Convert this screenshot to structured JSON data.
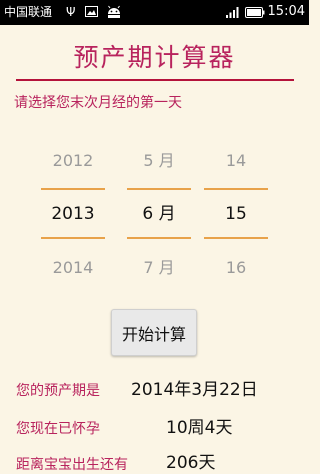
{
  "status_bar": {
    "carrier": "中国联通",
    "time": "15:04",
    "icons": [
      "usb-icon",
      "image-icon",
      "android-icon",
      "signal-icon",
      "battery-icon"
    ]
  },
  "app": {
    "title": "预产期计算器",
    "instruction": "请选择您末次月经的第一天"
  },
  "picker": {
    "year": {
      "prev": "2012",
      "selected": "2013",
      "next": "2014"
    },
    "month": {
      "prev": "5 月",
      "selected": "6 月",
      "next": "7 月"
    },
    "day": {
      "prev": "14",
      "selected": "15",
      "next": "16"
    }
  },
  "start_button": {
    "label": "开始计算"
  },
  "results": {
    "due_date_label": "您的预产期是",
    "due_date_value": "2014年3月22日",
    "pregnant_label": "您现在已怀孕",
    "pregnant_value": "10周4天",
    "remaining_label": "距离宝宝出生还有",
    "remaining_value": "206天"
  },
  "colors": {
    "accent": "#b8235d",
    "rule": "#b4123a",
    "picker_line": "#e8a24a",
    "background": "#fbf5e5"
  }
}
